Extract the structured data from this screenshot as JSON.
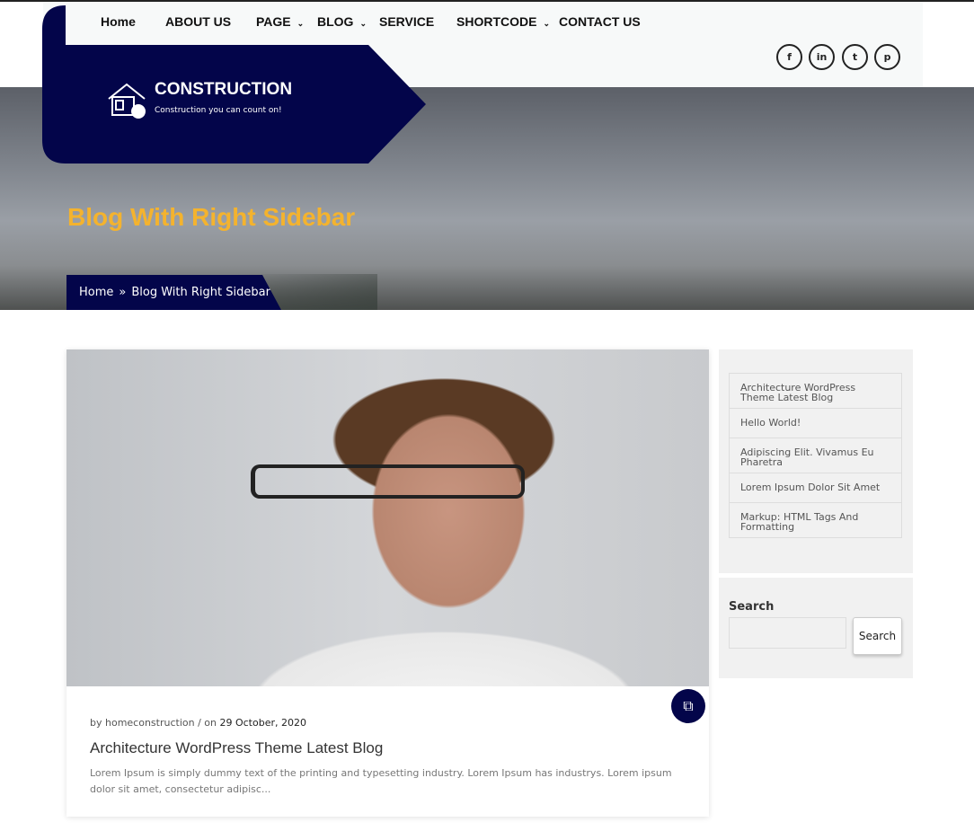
{
  "nav": {
    "items": [
      {
        "label": "Home"
      },
      {
        "label": "ABOUT US"
      },
      {
        "label": "PAGE",
        "dropdown": true
      },
      {
        "label": "BLOG",
        "dropdown": true
      },
      {
        "label": "SERVICE"
      },
      {
        "label": "SHORTCODE",
        "dropdown": true
      },
      {
        "label": "CONTACT US"
      }
    ],
    "chevron": "⌄"
  },
  "social": [
    {
      "icon": "facebook-icon",
      "glyph": "f"
    },
    {
      "icon": "linkedin-icon",
      "glyph": "in"
    },
    {
      "icon": "twitter-icon",
      "glyph": "t"
    },
    {
      "icon": "pinterest-icon",
      "glyph": "p"
    }
  ],
  "logo": {
    "name": "CONSTRUCTION",
    "tagline": "Construction you can count on!"
  },
  "hero": {
    "title": "Blog With Right Sidebar",
    "breadcrumb": {
      "home": "Home",
      "sep": "»",
      "current": "Blog With Right Sidebar"
    }
  },
  "post": {
    "by": "by homeconstruction / on",
    "date": "29 October, 2020",
    "title": "Architecture WordPress Theme Latest Blog",
    "excerpt": "Lorem Ipsum is simply dummy text of the printing and typesetting industry. Lorem Ipsum has industrys. Lorem ipsum dolor sit amet, consectetur adipisc..."
  },
  "sidebar": {
    "recent": [
      "Architecture WordPress Theme Latest Blog",
      "Hello World!",
      "Adipiscing Elit. Vivamus Eu Pharetra",
      "Lorem Ipsum Dolor Sit Amet",
      "Markup: HTML Tags And Formatting"
    ],
    "search_label": "Search",
    "search_button": "Search",
    "search_value": ""
  },
  "colors": {
    "navy": "#03054a",
    "accent": "#f4b32e"
  }
}
